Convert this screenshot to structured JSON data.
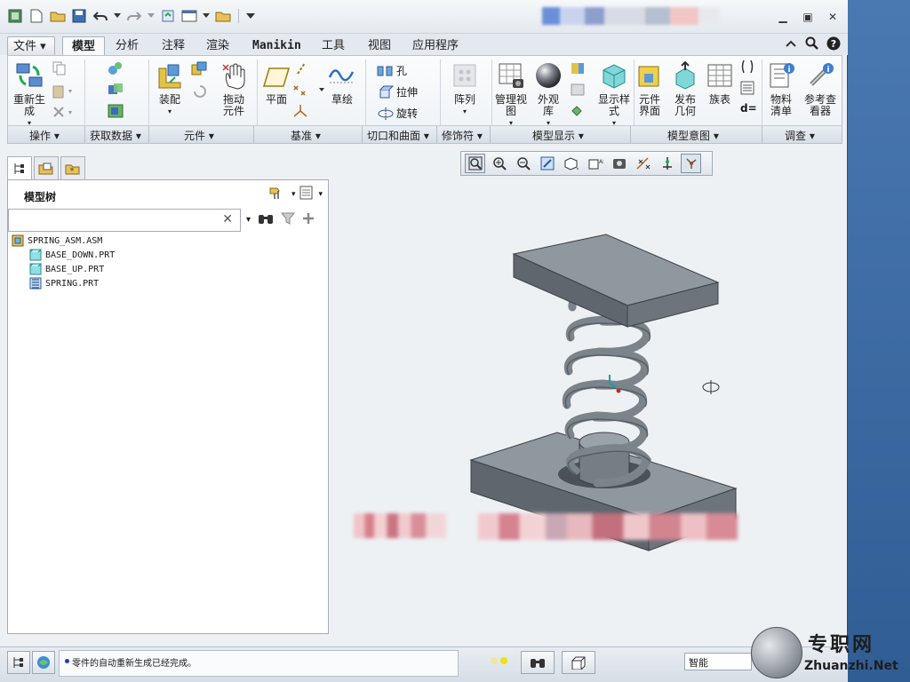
{
  "ribbon_tabs": [
    "文件",
    "模型",
    "分析",
    "注释",
    "渲染",
    "Manikin",
    "工具",
    "视图",
    "应用程序"
  ],
  "active_tab": "模型",
  "ribbon": {
    "regenerate": "重新生成",
    "assemble": "装配",
    "drag_components": "拖动元件",
    "plane": "平面",
    "sketch": "草绘",
    "hole": "孔",
    "extrude": "拉伸",
    "revolve": "旋转",
    "pattern": "阵列",
    "manage_views": "管理视图",
    "appearance_gallery": "外观库",
    "display_style": "显示样式",
    "component_interface": "元件界面",
    "publish_geometry": "发布几何",
    "family_table": "族表",
    "d_equals": "d=",
    "bill_of_materials": "物料清单",
    "reference_viewer": "参考查看器"
  },
  "groups": [
    "操作",
    "获取数据",
    "元件",
    "基准",
    "切口和曲面",
    "修饰符",
    "模型显示",
    "模型意图",
    "调查"
  ],
  "panel": {
    "title": "模型树",
    "search_clear": "✕"
  },
  "tree": [
    {
      "label": "SPRING_ASM.ASM",
      "type": "assembly"
    },
    {
      "label": "BASE_DOWN.PRT",
      "type": "part"
    },
    {
      "label": "BASE_UP.PRT",
      "type": "part"
    },
    {
      "label": "SPRING.PRT",
      "type": "part-spring"
    }
  ],
  "status": {
    "message": "零件的自动重新生成已经完成。",
    "filter_value": "智能"
  },
  "watermark": {
    "cn": "专职网",
    "en": "Zhuanzhi.Net"
  },
  "colors": {
    "model_gray": "#7e8790",
    "ribbon_bg": "#f3f6f9",
    "desktop_blue": "#3f6aa0"
  }
}
